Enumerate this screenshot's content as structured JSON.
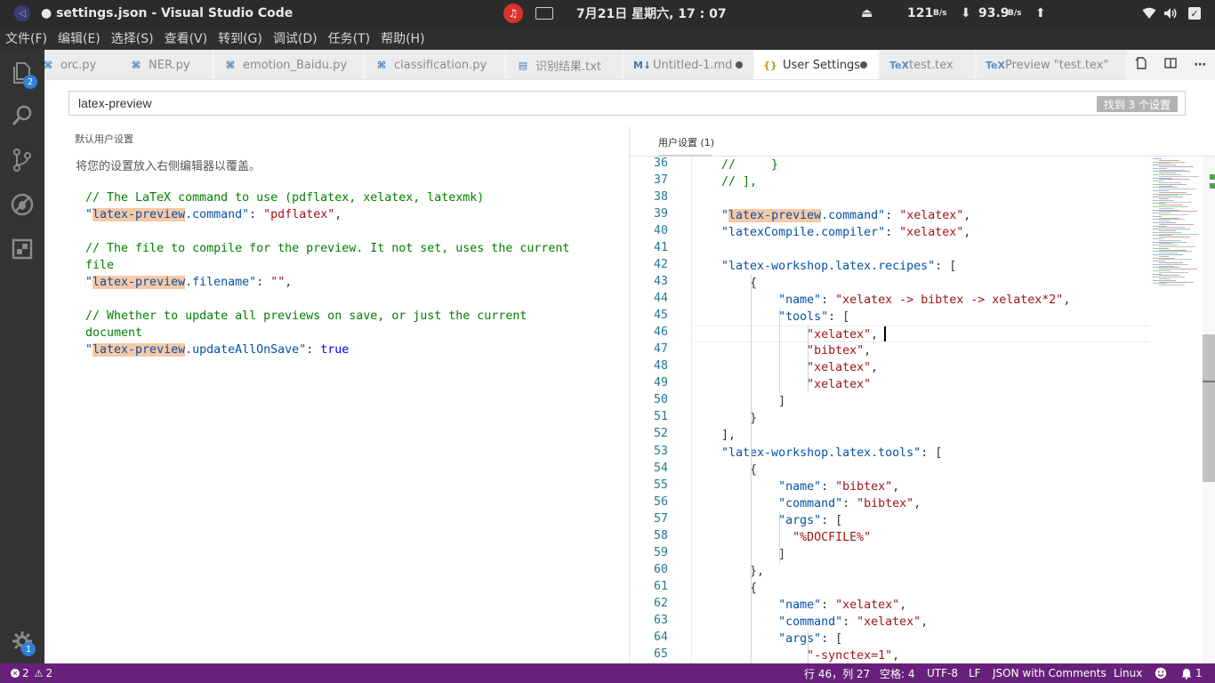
{
  "system": {
    "title": "● settings.json - Visual Studio Code",
    "clock": "7月21日 星期六, 17 : 07",
    "net_up_value": "121",
    "net_up_unit": "B/s",
    "net_down_value": "93.9",
    "net_down_unit": "B/s"
  },
  "menu": [
    "文件(F)",
    "编辑(E)",
    "选择(S)",
    "查看(V)",
    "转到(G)",
    "调试(D)",
    "任务(T)",
    "帮助(H)"
  ],
  "activity": {
    "explorer_badge": "2",
    "settings_badge": "1"
  },
  "tabs": [
    {
      "label": "orc.py",
      "type": "py"
    },
    {
      "label": "NER.py",
      "type": "py"
    },
    {
      "label": "emotion_Baidu.py",
      "type": "py"
    },
    {
      "label": "classification.py",
      "type": "py"
    },
    {
      "label": "识别结果.txt",
      "type": "txt"
    },
    {
      "label": "Untitled-1.md",
      "type": "md"
    },
    {
      "label": "User Settings",
      "type": "json"
    },
    {
      "label": "test.tex",
      "type": "tex"
    },
    {
      "label": "Preview \"test.tex\"",
      "type": "tex"
    }
  ],
  "search": {
    "value": "latex-preview",
    "found": "找到 3 个设置"
  },
  "left": {
    "title": "默认用户设置",
    "description": "将您的设置放入右侧编辑器以覆盖。",
    "comment1": "// The LaTeX command to use (pdflatex, xelatex, latexmk)",
    "key1_hl": "latex-preview",
    "key1_rest": ".command",
    "val1": "\"pdflatex\"",
    "comment2a": "// The file to compile for the preview. It not set, uses the current",
    "comment2b": "file",
    "key2_hl": "latex-preview",
    "key2_rest": ".filename",
    "val2": "\"\"",
    "comment3a": "// Whether to update all previews on save, or just the current",
    "comment3b": "document",
    "key3_hl": "latex-preview",
    "key3_rest": ".updateAllOnSave",
    "val3": "true"
  },
  "right": {
    "title": "用户设置 (1)"
  },
  "editor": {
    "line_numbers": [
      "36",
      "37",
      "38",
      "39",
      "40",
      "41",
      "42",
      "43",
      "44",
      "45",
      "46",
      "47",
      "48",
      "49",
      "50",
      "51",
      "52",
      "53",
      "54",
      "55",
      "56",
      "57",
      "58",
      "59",
      "60",
      "61",
      "62",
      "63",
      "64",
      "65"
    ],
    "lines": [
      [
        {
          "t": "    //     }",
          "c": "cmt"
        }
      ],
      [
        {
          "t": "    // ],",
          "c": "cmt"
        }
      ],
      [],
      [
        {
          "t": "    \"",
          "c": "key"
        },
        {
          "t": "latex-preview",
          "c": "key hl"
        },
        {
          "t": ".command\"",
          "c": "key"
        },
        {
          "t": ": ",
          "c": "pun"
        },
        {
          "t": "\"xelatex\"",
          "c": "str"
        },
        {
          "t": ",",
          "c": "pun"
        }
      ],
      [
        {
          "t": "    \"latexCompile.compiler\"",
          "c": "key"
        },
        {
          "t": ": ",
          "c": "pun"
        },
        {
          "t": "\"xelatex\"",
          "c": "str"
        },
        {
          "t": ",",
          "c": "pun"
        }
      ],
      [],
      [
        {
          "t": "    \"latex-workshop.latex.recipes\"",
          "c": "key"
        },
        {
          "t": ": [",
          "c": "pun"
        }
      ],
      [
        {
          "t": "        {",
          "c": "pun"
        }
      ],
      [
        {
          "t": "            \"name\"",
          "c": "key"
        },
        {
          "t": ": ",
          "c": "pun"
        },
        {
          "t": "\"xelatex -> bibtex -> xelatex*2\"",
          "c": "str"
        },
        {
          "t": ",",
          "c": "pun"
        }
      ],
      [
        {
          "t": "            \"tools\"",
          "c": "key"
        },
        {
          "t": ": [",
          "c": "pun"
        }
      ],
      [
        {
          "t": "                ",
          "c": "pun"
        },
        {
          "t": "\"xelatex\"",
          "c": "str"
        },
        {
          "t": ",",
          "c": "pun"
        }
      ],
      [
        {
          "t": "                ",
          "c": "pun"
        },
        {
          "t": "\"bibtex\"",
          "c": "str"
        },
        {
          "t": ",",
          "c": "pun"
        }
      ],
      [
        {
          "t": "                ",
          "c": "pun"
        },
        {
          "t": "\"xelatex\"",
          "c": "str"
        },
        {
          "t": ",",
          "c": "pun"
        }
      ],
      [
        {
          "t": "                ",
          "c": "pun"
        },
        {
          "t": "\"xelatex\"",
          "c": "str"
        }
      ],
      [
        {
          "t": "            ]",
          "c": "pun"
        }
      ],
      [
        {
          "t": "        }",
          "c": "pun"
        }
      ],
      [
        {
          "t": "    ],",
          "c": "pun"
        }
      ],
      [
        {
          "t": "    \"latex-workshop.latex.tools\"",
          "c": "key"
        },
        {
          "t": ": [",
          "c": "pun"
        }
      ],
      [
        {
          "t": "        {",
          "c": "pun"
        }
      ],
      [
        {
          "t": "            \"name\"",
          "c": "key"
        },
        {
          "t": ": ",
          "c": "pun"
        },
        {
          "t": "\"bibtex\"",
          "c": "str"
        },
        {
          "t": ",",
          "c": "pun"
        }
      ],
      [
        {
          "t": "            \"command\"",
          "c": "key"
        },
        {
          "t": ": ",
          "c": "pun"
        },
        {
          "t": "\"bibtex\"",
          "c": "str"
        },
        {
          "t": ",",
          "c": "pun"
        }
      ],
      [
        {
          "t": "            \"args\"",
          "c": "key"
        },
        {
          "t": ": [",
          "c": "pun"
        }
      ],
      [
        {
          "t": "              ",
          "c": "pun"
        },
        {
          "t": "\"%DOCFILE%\"",
          "c": "str"
        }
      ],
      [
        {
          "t": "            ]",
          "c": "pun"
        }
      ],
      [
        {
          "t": "        },",
          "c": "pun"
        }
      ],
      [
        {
          "t": "        {",
          "c": "pun"
        }
      ],
      [
        {
          "t": "            \"name\"",
          "c": "key"
        },
        {
          "t": ": ",
          "c": "pun"
        },
        {
          "t": "\"xelatex\"",
          "c": "str"
        },
        {
          "t": ",",
          "c": "pun"
        }
      ],
      [
        {
          "t": "            \"command\"",
          "c": "key"
        },
        {
          "t": ": ",
          "c": "pun"
        },
        {
          "t": "\"xelatex\"",
          "c": "str"
        },
        {
          "t": ",",
          "c": "pun"
        }
      ],
      [
        {
          "t": "            \"args\"",
          "c": "key"
        },
        {
          "t": ": [",
          "c": "pun"
        }
      ],
      [
        {
          "t": "                ",
          "c": "pun"
        },
        {
          "t": "\"-synctex=1\"",
          "c": "str"
        },
        {
          "t": ",",
          "c": "pun"
        }
      ]
    ]
  },
  "status": {
    "errors": "2",
    "warnings": "2",
    "position": "行 46，列 27",
    "spaces": "空格: 4",
    "encoding": "UTF-8",
    "eol": "LF",
    "language": "JSON with Comments",
    "os": "Linux",
    "notifications": "1"
  }
}
